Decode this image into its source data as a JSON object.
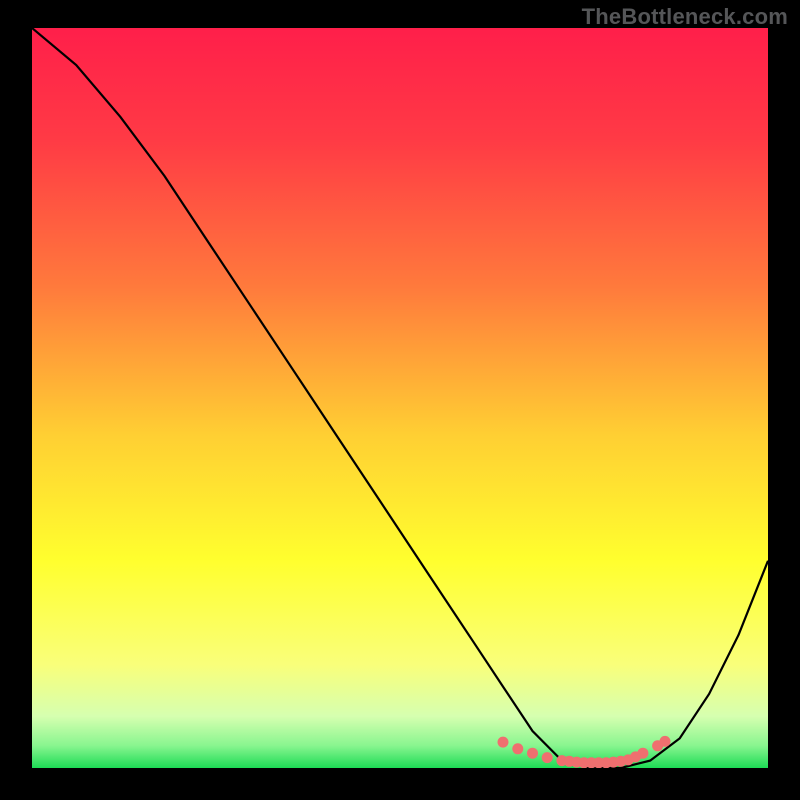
{
  "watermark": {
    "text": "TheBottleneck.com"
  },
  "chart_data": {
    "type": "line",
    "title": "",
    "xlabel": "",
    "ylabel": "",
    "xlim": [
      0,
      100
    ],
    "ylim": [
      0,
      100
    ],
    "grid": false,
    "curve": {
      "name": "bottleneck-curve",
      "x": [
        0,
        6,
        12,
        18,
        24,
        30,
        36,
        42,
        48,
        54,
        60,
        64,
        68,
        72,
        76,
        80,
        84,
        88,
        92,
        96,
        100
      ],
      "y": [
        100,
        95,
        88,
        80,
        71,
        62,
        53,
        44,
        35,
        26,
        17,
        11,
        5,
        1,
        0,
        0,
        1,
        4,
        10,
        18,
        28
      ]
    },
    "highlight_zone": {
      "y_from": 0,
      "y_to": 6
    },
    "markers": {
      "name": "flat-region-markers",
      "x": [
        64,
        66,
        68,
        70,
        72,
        73,
        74,
        75,
        76,
        77,
        78,
        79,
        80,
        81,
        82,
        83,
        85,
        86
      ],
      "y": [
        3.5,
        2.6,
        2.0,
        1.4,
        1.0,
        0.9,
        0.8,
        0.7,
        0.7,
        0.7,
        0.7,
        0.8,
        0.9,
        1.1,
        1.5,
        2.0,
        3.0,
        3.6
      ]
    },
    "gradient_stops": [
      {
        "pos": 0.0,
        "color": "#ff1f4a"
      },
      {
        "pos": 0.15,
        "color": "#ff3a45"
      },
      {
        "pos": 0.35,
        "color": "#ff7a3c"
      },
      {
        "pos": 0.55,
        "color": "#ffcf33"
      },
      {
        "pos": 0.72,
        "color": "#ffff2e"
      },
      {
        "pos": 0.86,
        "color": "#f9ff7a"
      },
      {
        "pos": 0.93,
        "color": "#d6ffb0"
      },
      {
        "pos": 0.97,
        "color": "#88f58f"
      },
      {
        "pos": 1.0,
        "color": "#1ddb55"
      }
    ]
  }
}
